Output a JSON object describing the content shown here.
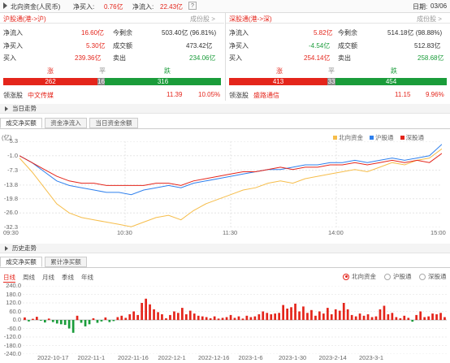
{
  "header": {
    "title": "北向资金(人民币)",
    "net_buy_label": "净买入:",
    "net_buy_value": "0.76亿",
    "net_inflow_label": "净流入:",
    "net_inflow_value": "22.43亿",
    "help": "?",
    "date_label": "日期:",
    "date_value": "03/06"
  },
  "sh": {
    "title": "沪股通(港->沪)",
    "link": "成份股 >",
    "inflow_label": "净流入",
    "inflow_value": "16.60亿",
    "remain_label": "今剩余",
    "remain_value": "503.40亿 (96.81%)",
    "netbuy_label": "净买入",
    "netbuy_value": "5.30亿",
    "turnover_label": "成交额",
    "turnover_value": "473.42亿",
    "buy_label": "买入",
    "buy_value": "239.36亿",
    "sell_label": "卖出",
    "sell_value": "234.06亿",
    "rise_label": "涨",
    "flat_label": "平",
    "fall_label": "跌",
    "rise": "262",
    "flat": "16",
    "fall": "316",
    "rise_n": 262,
    "flat_n": 16,
    "fall_n": 316,
    "leader_label": "领涨股",
    "leader_name": "中文传媒",
    "leader_price": "11.39",
    "leader_pct": "10.05%"
  },
  "sz": {
    "title": "深股通(港->深)",
    "link": "成份股 >",
    "inflow_label": "净流入",
    "inflow_value": "5.82亿",
    "remain_label": "今剩余",
    "remain_value": "514.18亿 (98.88%)",
    "netbuy_label": "净买入",
    "netbuy_value": "-4.54亿",
    "turnover_label": "成交额",
    "turnover_value": "512.83亿",
    "buy_label": "买入",
    "buy_value": "254.14亿",
    "sell_label": "卖出",
    "sell_value": "258.68亿",
    "rise_label": "涨",
    "flat_label": "平",
    "fall_label": "跌",
    "rise": "413",
    "flat": "33",
    "fall": "454",
    "rise_n": 413,
    "flat_n": 33,
    "fall_n": 454,
    "leader_label": "领涨股",
    "leader_name": "盛路通信",
    "leader_price": "11.15",
    "leader_pct": "9.96%"
  },
  "intraday": {
    "section_title": "当日走势",
    "tabs": [
      "成交净买额",
      "资金净流入",
      "当日资金余额"
    ]
  },
  "history": {
    "section_title": "历史走势",
    "tabs": [
      "成交净买额",
      "累计净买额"
    ],
    "periods": [
      "日线",
      "周线",
      "月线",
      "季线",
      "年线"
    ],
    "radios": [
      "北向资金",
      "沪股通",
      "深股通"
    ]
  },
  "colors": {
    "north": "#f6bd4a",
    "sh": "#2f80ed",
    "sz": "#e4251b",
    "up": "#e4251b",
    "down": "#1a9c3a"
  },
  "chart_data": [
    {
      "type": "line",
      "unit_label": "(亿)",
      "y_ticks": [
        "5.3",
        "-1.0",
        "-7.3",
        "-13.8",
        "-19.8",
        "-26.0",
        "-32.3"
      ],
      "ylim": [
        -32.3,
        5.3
      ],
      "x_ticks": [
        "09:30",
        "10:30",
        "11:30",
        "14:00",
        "15:00"
      ],
      "legend": [
        "北向资金",
        "沪股通",
        "深股通"
      ],
      "series": [
        {
          "name": "北向资金",
          "values": [
            -2,
            -8,
            -15,
            -22,
            -26,
            -28,
            -29,
            -30,
            -31,
            -32,
            -30,
            -28,
            -27,
            -29,
            -25,
            -22,
            -20,
            -18,
            -16,
            -15,
            -13,
            -12,
            -13,
            -11,
            -10,
            -9,
            -8,
            -7,
            -8,
            -6,
            -4,
            -5,
            -3,
            -2,
            2
          ]
        },
        {
          "name": "沪股通",
          "values": [
            -1,
            -4,
            -8,
            -12,
            -14,
            -15,
            -16,
            -17,
            -17,
            -18,
            -16,
            -15,
            -14,
            -15,
            -13,
            -12,
            -11,
            -10,
            -9,
            -8,
            -7,
            -7,
            -6,
            -5,
            -5,
            -4,
            -4,
            -3,
            -4,
            -3,
            -2,
            -3,
            -2,
            -1,
            4
          ]
        },
        {
          "name": "深股通",
          "values": [
            -1,
            -4,
            -7,
            -10,
            -12,
            -13,
            -13,
            -14,
            -14,
            -14,
            -14,
            -13,
            -13,
            -14,
            -12,
            -11,
            -10,
            -9,
            -8,
            -8,
            -7,
            -6,
            -7,
            -6,
            -6,
            -5,
            -5,
            -4,
            -5,
            -4,
            -3,
            -4,
            -3,
            -4,
            0
          ]
        }
      ]
    },
    {
      "type": "bar",
      "y_ticks": [
        "240.0",
        "180.0",
        "120.0",
        "60.0",
        "0.0",
        "-60.0",
        "-120.0",
        "-180.0",
        "-240.0"
      ],
      "ylim": [
        -240,
        240
      ],
      "x_ticks": [
        "2022-10-17",
        "2022-11-1",
        "2022-11-16",
        "2022-12-1",
        "2022-12-16",
        "2023-1-6",
        "2023-1-30",
        "2023-2-14",
        "2023-3-1"
      ],
      "values": [
        18,
        -10,
        8,
        22,
        -5,
        -18,
        10,
        -15,
        -25,
        -30,
        -35,
        -60,
        -90,
        30,
        -20,
        -45,
        -30,
        12,
        -20,
        -10,
        18,
        -15,
        -8,
        20,
        30,
        15,
        40,
        60,
        35,
        120,
        150,
        110,
        75,
        55,
        40,
        12,
        35,
        60,
        50,
        85,
        40,
        65,
        45,
        30,
        25,
        20,
        12,
        25,
        10,
        15,
        20,
        35,
        15,
        25,
        10,
        30,
        20,
        25,
        40,
        60,
        50,
        40,
        45,
        50,
        105,
        80,
        90,
        115,
        60,
        95,
        50,
        70,
        30,
        60,
        45,
        85,
        40,
        75,
        65,
        120,
        75,
        35,
        25,
        45,
        30,
        40,
        20,
        25,
        75,
        100,
        40,
        50,
        20,
        12,
        30,
        15,
        -12,
        35,
        60,
        20,
        25,
        45,
        40,
        50,
        20
      ]
    }
  ]
}
